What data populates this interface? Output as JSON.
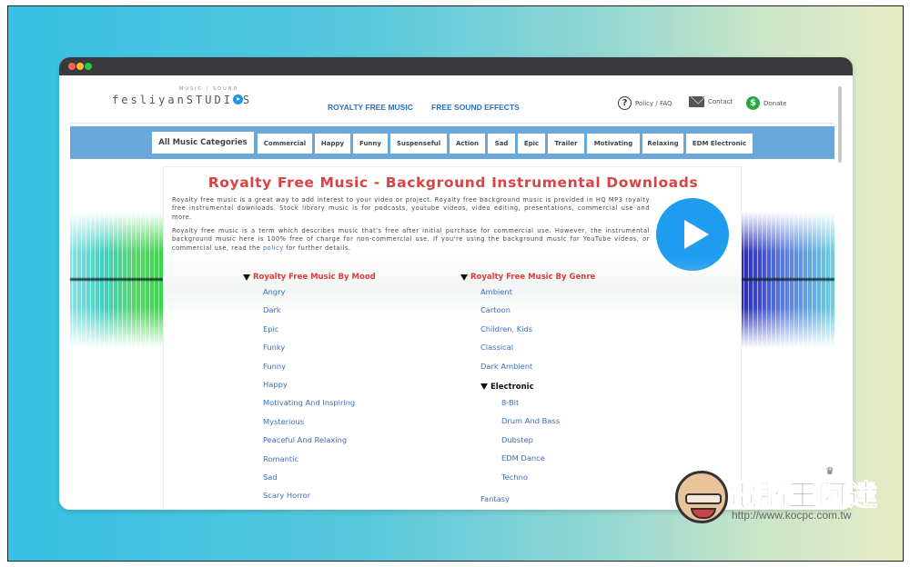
{
  "colors": {
    "accent_blue": "#1e9cf0",
    "category_bar": "#6aa8dc",
    "title_red": "#d94343",
    "link_blue": "#3a6db8",
    "donate_green": "#27a845"
  },
  "window": {
    "controls": [
      "close",
      "minimize",
      "maximize"
    ]
  },
  "header": {
    "logo": {
      "tagline": "MUSIC / SOUND",
      "name_left": "fesliyan",
      "name_right_a": "STUDI",
      "name_right_b": "S",
      "icon": "play-circle-icon"
    },
    "nav": [
      {
        "label": "ROYALTY FREE MUSIC"
      },
      {
        "label": "FREE SOUND EFFECTS"
      }
    ],
    "utilities": [
      {
        "label": "Policy / FAQ",
        "icon": "question-circle-icon",
        "glyph": "?"
      },
      {
        "label": "Contact",
        "icon": "envelope-icon"
      },
      {
        "label": "Donate",
        "icon": "dollar-circle-icon",
        "glyph": "$"
      }
    ]
  },
  "categories": [
    {
      "label": "All Music Categories",
      "active": true
    },
    {
      "label": "Commercial"
    },
    {
      "label": "Happy"
    },
    {
      "label": "Funny"
    },
    {
      "label": "Suspenseful"
    },
    {
      "label": "Action"
    },
    {
      "label": "Sad"
    },
    {
      "label": "Epic"
    },
    {
      "label": "Trailer"
    },
    {
      "label": "Motivating"
    },
    {
      "label": "Relaxing"
    },
    {
      "label": "EDM Electronic"
    }
  ],
  "main": {
    "title": "Royalty Free Music - Background Instrumental Downloads",
    "paragraph1": "Royalty free music is a great way to add interest to your video or project. Royalty free background music is provided in HQ MP3 royalty free instrumental downloads. Stock library music is for podcasts, youtube videos, video editing, presentations, commercial use and more.",
    "paragraph2_before": "Royalty free music is a term which describes music that's free after initial purchase for commercial use. However, the instrumental background music here is 100% free of charge for non-commercial use. If you're using the background music for YouTube videos, or commercial use, read the ",
    "paragraph2_link": "policy",
    "paragraph2_after": " for further details.",
    "play_button_icon": "play-icon"
  },
  "mood": {
    "heading": "Royalty Free Music By Mood",
    "items": [
      "Angry",
      "Dark",
      "Epic",
      "Funky",
      "Funny",
      "Happy",
      "Motivating And Inspiring",
      "Mysterious",
      "Peaceful And Relaxing",
      "Romantic",
      "Sad",
      "Scary Horror"
    ]
  },
  "genre": {
    "heading": "Royalty Free Music By Genre",
    "items": [
      "Ambient",
      "Cartoon",
      "Children, Kids",
      "Classical",
      "Dark Ambient"
    ],
    "electronic": {
      "heading": "Electronic",
      "items": [
        "8-Bit",
        "Drum And Bass",
        "Dubstep",
        "EDM Dance",
        "Techno"
      ]
    },
    "after": [
      "Fantasy"
    ]
  },
  "watermark": {
    "title": "電腦王阿達",
    "url": "http://www.kocpc.com.tw",
    "crown": "♛"
  }
}
